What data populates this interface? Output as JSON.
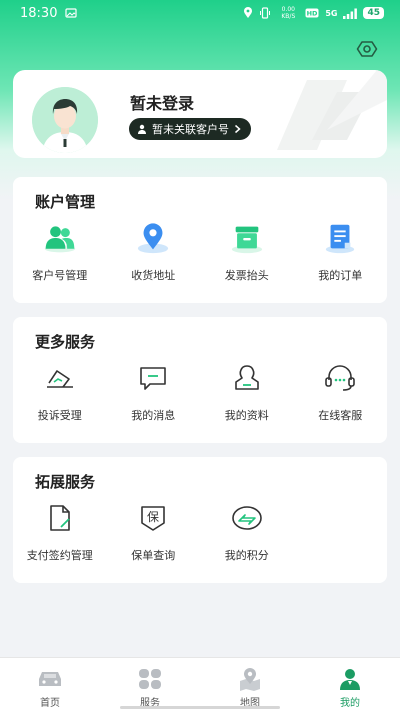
{
  "status_bar": {
    "time": "18:30",
    "network_speed": "0.00 KB/S",
    "signal": "5G",
    "battery": "45"
  },
  "profile": {
    "login_text": "暂未登录",
    "link_text": "暂未关联客户号"
  },
  "sections": [
    {
      "title": "账户管理",
      "items": [
        {
          "label": "客户号管理",
          "icon": "people-icon"
        },
        {
          "label": "收货地址",
          "icon": "location-pin-icon"
        },
        {
          "label": "发票抬头",
          "icon": "invoice-icon"
        },
        {
          "label": "我的订单",
          "icon": "order-document-icon"
        }
      ]
    },
    {
      "title": "更多服务",
      "items": [
        {
          "label": "投诉受理",
          "icon": "complaint-icon"
        },
        {
          "label": "我的消息",
          "icon": "message-icon"
        },
        {
          "label": "我的资料",
          "icon": "profile-icon"
        },
        {
          "label": "在线客服",
          "icon": "headset-icon"
        }
      ]
    },
    {
      "title": "拓展服务",
      "items": [
        {
          "label": "支付签约管理",
          "icon": "sign-document-icon"
        },
        {
          "label": "保单查询",
          "icon": "policy-icon"
        },
        {
          "label": "我的积分",
          "icon": "points-icon"
        }
      ]
    }
  ],
  "policy_icon_char": "保",
  "tabbar": [
    {
      "label": "首页",
      "icon": "car-icon",
      "active": false
    },
    {
      "label": "服务",
      "icon": "grid-icon",
      "active": false
    },
    {
      "label": "地图",
      "icon": "map-icon",
      "active": false
    },
    {
      "label": "我的",
      "icon": "user-icon",
      "active": true
    }
  ],
  "colors": {
    "brand_green": "#1fd08a",
    "active_tab": "#1b9c63",
    "pill_dark": "#1d2a23"
  }
}
